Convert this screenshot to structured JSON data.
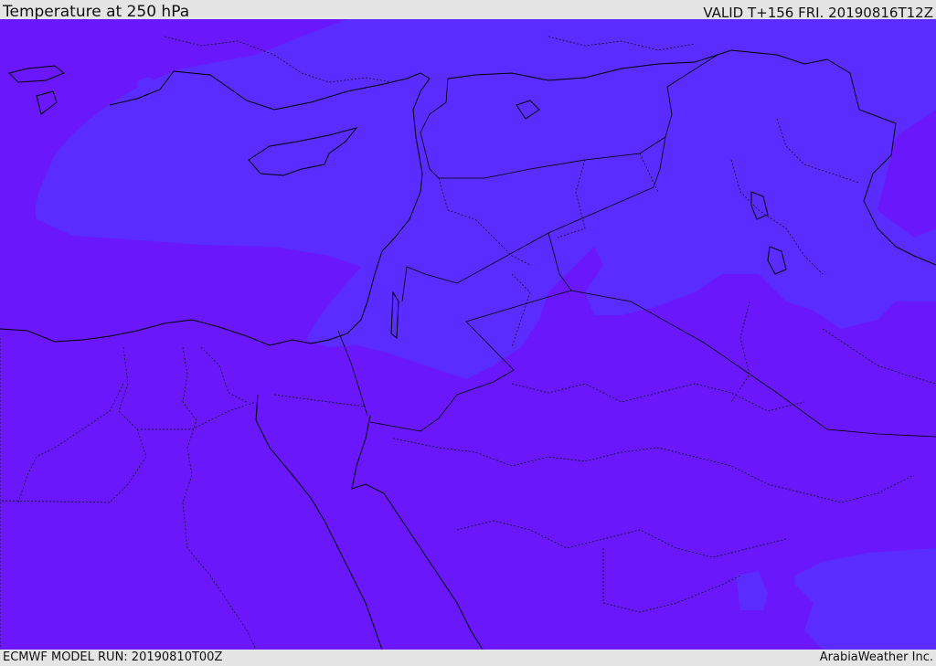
{
  "header": {
    "title": "Temperature at 250 hPa",
    "valid_time": "VALID T+156 FRI. 20190816T12Z"
  },
  "footer": {
    "model_run": "ECMWF MODEL RUN: 20190810T00Z",
    "credit": "ArabiaWeather Inc."
  },
  "map": {
    "colors": {
      "background_field": "#6a17fb",
      "warmer_field": "#5a2cff",
      "coastline": "#000000",
      "border": "#000000"
    }
  }
}
